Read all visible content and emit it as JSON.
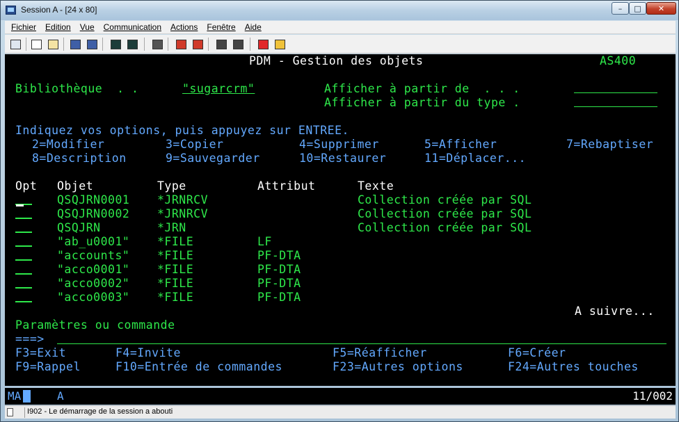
{
  "window": {
    "title": "Session A - [24 x 80]",
    "minimize": "–",
    "maximize": "□",
    "close": "✕"
  },
  "menu": [
    "Fichier",
    "Edition",
    "Vue",
    "Communication",
    "Actions",
    "Fenêtre",
    "Aide"
  ],
  "toolbar_icons": [
    "print-screen-icon",
    "copy-icon",
    "paste-icon",
    "send-file-icon",
    "receive-file-icon",
    "display-icon",
    "keypad-icon",
    "macro-icon",
    "record-macro-icon",
    "stop-macro-icon",
    "play-macro-icon",
    "play-macro-2-icon",
    "help-icon"
  ],
  "screen": {
    "header": {
      "title": "PDM - Gestion des objets",
      "system": "AS400"
    },
    "library_label": "Bibliothèque  . .",
    "library_value": "\"sugarcrm\"",
    "position_to_label": "Afficher à partir de  . . .",
    "position_to_type_label": "Afficher à partir du type .",
    "instructions": "Indiquez vos options, puis appuyez sur ENTREE.",
    "options_row1": [
      {
        "text": "2=Modifier"
      },
      {
        "text": "3=Copier"
      },
      {
        "text": "4=Supprimer"
      },
      {
        "text": "5=Afficher"
      },
      {
        "text": "7=Rebaptiser"
      }
    ],
    "options_row2": [
      {
        "text": "8=Description"
      },
      {
        "text": "9=Sauvegarder"
      },
      {
        "text": "10=Restaurer"
      },
      {
        "text": "11=Déplacer..."
      }
    ],
    "columns": {
      "opt": "Opt",
      "object": "Objet",
      "type": "Type",
      "attribute": "Attribut",
      "text": "Texte"
    },
    "rows": [
      {
        "object": "QSQJRN0001",
        "type": "*JRNRCV",
        "attribute": "",
        "text": "Collection créée par SQL"
      },
      {
        "object": "QSQJRN0002",
        "type": "*JRNRCV",
        "attribute": "",
        "text": "Collection créée par SQL"
      },
      {
        "object": "QSQJRN",
        "type": "*JRN",
        "attribute": "",
        "text": "Collection créée par SQL"
      },
      {
        "object": "\"ab_u0001\"",
        "type": "*FILE",
        "attribute": "LF",
        "text": ""
      },
      {
        "object": "\"accounts\"",
        "type": "*FILE",
        "attribute": "PF-DTA",
        "text": ""
      },
      {
        "object": "\"acco0001\"",
        "type": "*FILE",
        "attribute": "PF-DTA",
        "text": ""
      },
      {
        "object": "\"acco0002\"",
        "type": "*FILE",
        "attribute": "PF-DTA",
        "text": ""
      },
      {
        "object": "\"acco0003\"",
        "type": "*FILE",
        "attribute": "PF-DTA",
        "text": ""
      }
    ],
    "more": "A suivre...",
    "command_label": "Paramètres ou commande",
    "command_prompt": "===>",
    "fkeys_row1": [
      "F3=Exit",
      "F4=Invite",
      "F5=Réafficher",
      "F6=Créer"
    ],
    "fkeys_row2": [
      "F9=Rappel",
      "F10=Entrée de commandes",
      "F23=Autres options",
      "F24=Autres touches"
    ]
  },
  "oia": {
    "indicator": "MA",
    "mode": "A",
    "cursor_position": "11/002"
  },
  "status": {
    "message": "I902 - Le démarrage de la session a abouti"
  },
  "colors": {
    "green": "#2ee84a",
    "white": "#ffffff",
    "blue": "#63a9ff",
    "background": "#000000"
  }
}
